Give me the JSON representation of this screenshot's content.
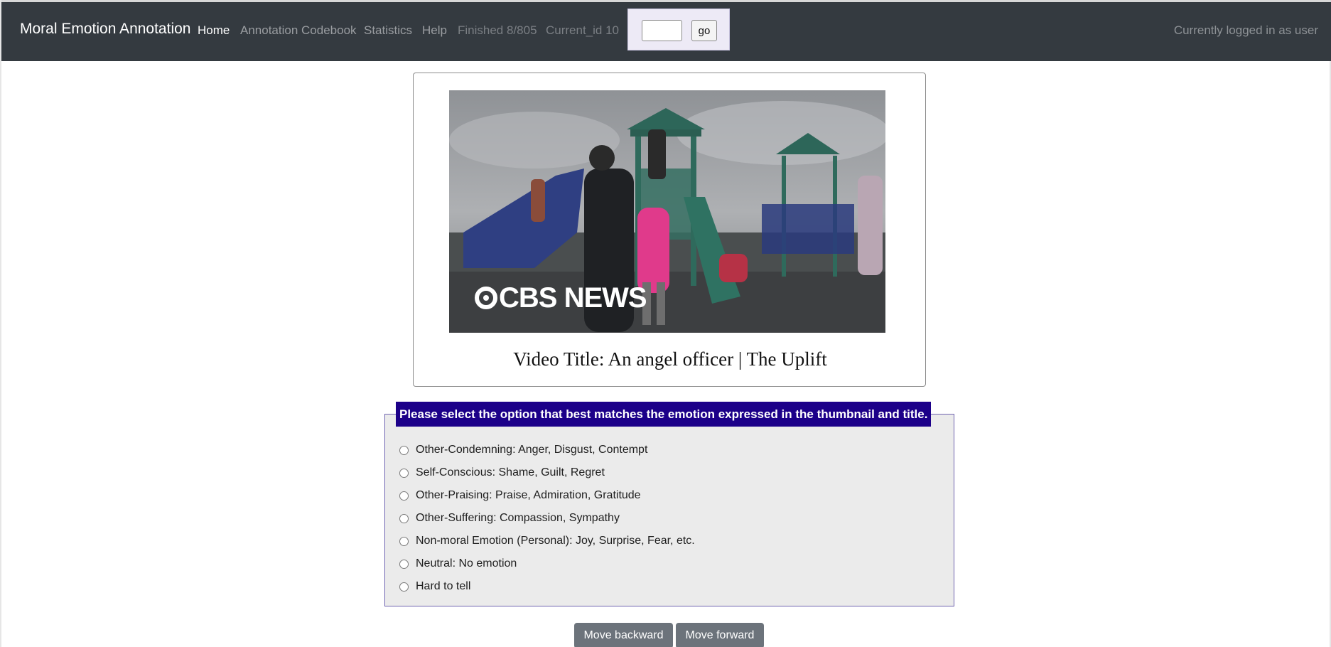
{
  "navbar": {
    "brand": "Moral Emotion Annotation",
    "links": [
      {
        "label": "Home",
        "state": "active"
      },
      {
        "label": "Annotation Codebook",
        "state": "link"
      },
      {
        "label": "Statistics",
        "state": "link"
      },
      {
        "label": "Help",
        "state": "link"
      }
    ],
    "progress": "Finished 8/805",
    "current_id": "Current_id 10",
    "goto": {
      "value": "",
      "button_label": "go"
    },
    "user_status": "Currently logged in as user"
  },
  "video": {
    "thumbnail_watermark": "CBS NEWS",
    "title": "Video Title: An angel officer | The Uplift"
  },
  "question": {
    "prompt": "Please select the option that best matches the emotion expressed in the thumbnail and title.",
    "options": [
      {
        "label": "Other-Condemning: Anger, Disgust, Contempt",
        "selected": false
      },
      {
        "label": "Self-Conscious: Shame, Guilt, Regret",
        "selected": false
      },
      {
        "label": "Other-Praising: Praise, Admiration, Gratitude",
        "selected": false
      },
      {
        "label": "Other-Suffering: Compassion, Sympathy",
        "selected": false
      },
      {
        "label": "Non-moral Emotion (Personal): Joy, Surprise, Fear, etc.",
        "selected": false
      },
      {
        "label": "Neutral: No emotion",
        "selected": false
      },
      {
        "label": "Hard to tell",
        "selected": false
      }
    ]
  },
  "actions": {
    "backward_label": "Move backward",
    "forward_label": "Move forward"
  }
}
